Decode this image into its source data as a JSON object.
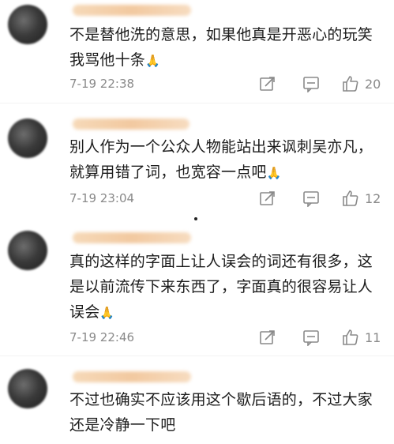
{
  "comments": [
    {
      "text": "不是替他洗的意思，如果他真是开恶心的玩笑我骂他十条",
      "emoji": "🙏",
      "time": "7-19 22:38",
      "likes": "20"
    },
    {
      "text": "别人作为一个公众人物能站出来讽刺吴亦凡，就算用错了词，也宽容一点吧",
      "emoji": "🙏",
      "time": "7-19 23:04",
      "likes": "12"
    },
    {
      "text": "真的这样的字面上让人误会的词还有很多，这是以前流传下来东西了，字面真的很容易让人误会",
      "emoji": "🙏",
      "time": "7-19 22:46",
      "likes": "11"
    },
    {
      "text": "不过也确实不应该用这个歇后语的，不过大家还是冷静一下吧",
      "emoji": "",
      "time": "",
      "likes": ""
    }
  ],
  "icons": {
    "forward": "share-icon",
    "reply": "comment-icon",
    "like": "thumbs-up-icon"
  },
  "colors": {
    "meta_text": "#8a8a8a",
    "body_text": "#1c1c1c",
    "username_blur": "#f2c9a0"
  }
}
